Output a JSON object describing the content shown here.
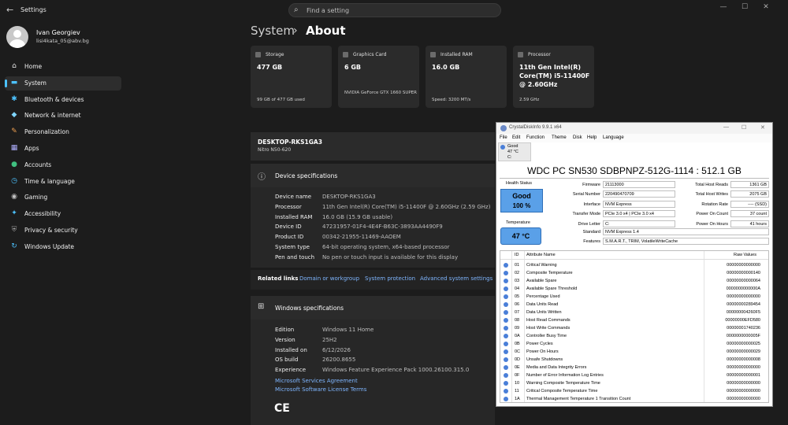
{
  "app": {
    "title": "Settings"
  },
  "search": {
    "placeholder": "Find a setting"
  },
  "user": {
    "name": "Ivan Georgiev",
    "email": "lisi4kata_05@abv.bg"
  },
  "sidebar": {
    "items": [
      {
        "label": "Home",
        "icon": "home-icon",
        "glyph": "⌂",
        "color": "#e8e8e8"
      },
      {
        "label": "System",
        "icon": "system-icon",
        "glyph": "▬",
        "color": "#4cc2ff",
        "selected": true
      },
      {
        "label": "Bluetooth & devices",
        "icon": "bluetooth-icon",
        "glyph": "✱",
        "color": "#4cc2ff"
      },
      {
        "label": "Network & internet",
        "icon": "network-icon",
        "glyph": "◆",
        "color": "#7fd4ff"
      },
      {
        "label": "Personalization",
        "icon": "personalization-icon",
        "glyph": "✎",
        "color": "#f0a050"
      },
      {
        "label": "Apps",
        "icon": "apps-icon",
        "glyph": "▦",
        "color": "#b0b0ff"
      },
      {
        "label": "Accounts",
        "icon": "accounts-icon",
        "glyph": "●",
        "color": "#40c080"
      },
      {
        "label": "Time & language",
        "icon": "time-icon",
        "glyph": "◷",
        "color": "#4cc2ff"
      },
      {
        "label": "Gaming",
        "icon": "gaming-icon",
        "glyph": "◉",
        "color": "#c0c0c0"
      },
      {
        "label": "Accessibility",
        "icon": "accessibility-icon",
        "glyph": "✦",
        "color": "#4cc2ff"
      },
      {
        "label": "Privacy & security",
        "icon": "shield-icon",
        "glyph": "⛨",
        "color": "#a0a0a0"
      },
      {
        "label": "Windows Update",
        "icon": "update-icon",
        "glyph": "↻",
        "color": "#4cc2ff"
      }
    ]
  },
  "breadcrumb": {
    "parent": "System",
    "separator": "›",
    "current": "About"
  },
  "cards": [
    {
      "caption": "Storage",
      "value": "477 GB",
      "sub": "99 GB of 477 GB used"
    },
    {
      "caption": "Graphics Card",
      "value": "6 GB",
      "sub": "NVIDIA GeForce GTX 1660 SUPER"
    },
    {
      "caption": "Installed RAM",
      "value": "16.0 GB",
      "sub": "Speed: 3200 MT/s"
    },
    {
      "caption": "Processor",
      "value": "11th Gen Intel(R) Core(TM) i5-11400F @ 2.60GHz",
      "sub": "2.59 GHz"
    }
  ],
  "device": {
    "name": "DESKTOP-RKS1GA3",
    "model": "Nitro N50-620"
  },
  "device_specs": {
    "title": "Device specifications",
    "rows": [
      {
        "label": "Device name",
        "value": "DESKTOP-RKS1GA3"
      },
      {
        "label": "Processor",
        "value": "11th Gen Intel(R) Core(TM) i5-11400F @ 2.60GHz (2.59 GHz)"
      },
      {
        "label": "Installed RAM",
        "value": "16.0 GB (15.9 GB usable)"
      },
      {
        "label": "Device ID",
        "value": "47231957-01F4-4E4F-B63C-3893AA4490F9"
      },
      {
        "label": "Product ID",
        "value": "00342-21955-11469-AAOEM"
      },
      {
        "label": "System type",
        "value": "64-bit operating system, x64-based processor"
      },
      {
        "label": "Pen and touch",
        "value": "No pen or touch input is available for this display"
      }
    ]
  },
  "related": {
    "label": "Related links",
    "links": [
      "Domain or workgroup",
      "System protection",
      "Advanced system settings"
    ]
  },
  "windows_specs": {
    "title": "Windows specifications",
    "rows": [
      {
        "label": "Edition",
        "value": "Windows 11 Home"
      },
      {
        "label": "Version",
        "value": "25H2"
      },
      {
        "label": "Installed on",
        "value": "6/12/2026"
      },
      {
        "label": "OS build",
        "value": "26200.8655"
      },
      {
        "label": "Experience",
        "value": "Windows Feature Experience Pack 1000.26100.315.0"
      }
    ],
    "links": [
      "Microsoft Services Agreement",
      "Microsoft Software License Terms"
    ],
    "ce": "CE"
  },
  "cdi": {
    "title": "CrystalDiskInfo 9.9.1 x64",
    "menu": [
      "File",
      "Edit",
      "Function",
      "Theme",
      "Disk",
      "Help",
      "Language"
    ],
    "tab": {
      "status": "Good",
      "temp": "47 °C",
      "drive": "C:"
    },
    "model": "WDC PC SN530 SDBPNPZ-512G-1114 : 512.1 GB",
    "health_label": "Health Status",
    "health_status": "Good",
    "health_percent": "100 %",
    "temp_label": "Temperature",
    "temperature": "47 °C",
    "fields_left": [
      {
        "label": "Firmware",
        "value": "21113000"
      },
      {
        "label": "Serial Number",
        "value": "220490470709"
      },
      {
        "label": "Interface",
        "value": "NVM Express"
      },
      {
        "label": "Transfer Mode",
        "value": "PCIe 3.0 x4 | PCIe 3.0 x4"
      },
      {
        "label": "Drive Letter",
        "value": "C:"
      }
    ],
    "fields_right": [
      {
        "label": "Total Host Reads",
        "value": "1361 GB"
      },
      {
        "label": "Total Host Writes",
        "value": "2075 GB"
      },
      {
        "label": "Rotation Rate",
        "value": "---- (SSD)"
      },
      {
        "label": "Power On Count",
        "value": "37 count"
      },
      {
        "label": "Power On Hours",
        "value": "41 hours"
      }
    ],
    "standard_label": "Standard",
    "standard": "NVM Express 1.4",
    "features_label": "Features",
    "features": "S.M.A.R.T., TRIM, VolatileWriteCache",
    "table_headers": {
      "id": "ID",
      "name": "Attribute Name",
      "raw": "Raw Values"
    },
    "attributes": [
      {
        "id": "01",
        "name": "Critical Warning",
        "raw": "00000000000000"
      },
      {
        "id": "02",
        "name": "Composite Temperature",
        "raw": "00000000000140"
      },
      {
        "id": "03",
        "name": "Available Spare",
        "raw": "00000000000064"
      },
      {
        "id": "04",
        "name": "Available Spare Threshold",
        "raw": "0000000000000A"
      },
      {
        "id": "05",
        "name": "Percentage Used",
        "raw": "00000000000000"
      },
      {
        "id": "06",
        "name": "Data Units Read",
        "raw": "00000000289454"
      },
      {
        "id": "07",
        "name": "Data Units Written",
        "raw": "000000004260F5"
      },
      {
        "id": "08",
        "name": "Host Read Commands",
        "raw": "00000000EFD580"
      },
      {
        "id": "09",
        "name": "Host Write Commands",
        "raw": "00000001740236"
      },
      {
        "id": "0A",
        "name": "Controller Busy Time",
        "raw": "0000000000005F"
      },
      {
        "id": "0B",
        "name": "Power Cycles",
        "raw": "00000000000025"
      },
      {
        "id": "0C",
        "name": "Power On Hours",
        "raw": "00000000000029"
      },
      {
        "id": "0D",
        "name": "Unsafe Shutdowns",
        "raw": "00000000000008"
      },
      {
        "id": "0E",
        "name": "Media and Data Integrity Errors",
        "raw": "00000000000000"
      },
      {
        "id": "0F",
        "name": "Number of Error Information Log Entries",
        "raw": "00000000000001"
      },
      {
        "id": "10",
        "name": "Warning Composite Temperature Time",
        "raw": "00000000000000"
      },
      {
        "id": "11",
        "name": "Critical Composite Temperature Time",
        "raw": "00000000000000"
      },
      {
        "id": "1A",
        "name": "Thermal Management Temperature 1 Transition Count",
        "raw": "00000000000000"
      }
    ]
  }
}
